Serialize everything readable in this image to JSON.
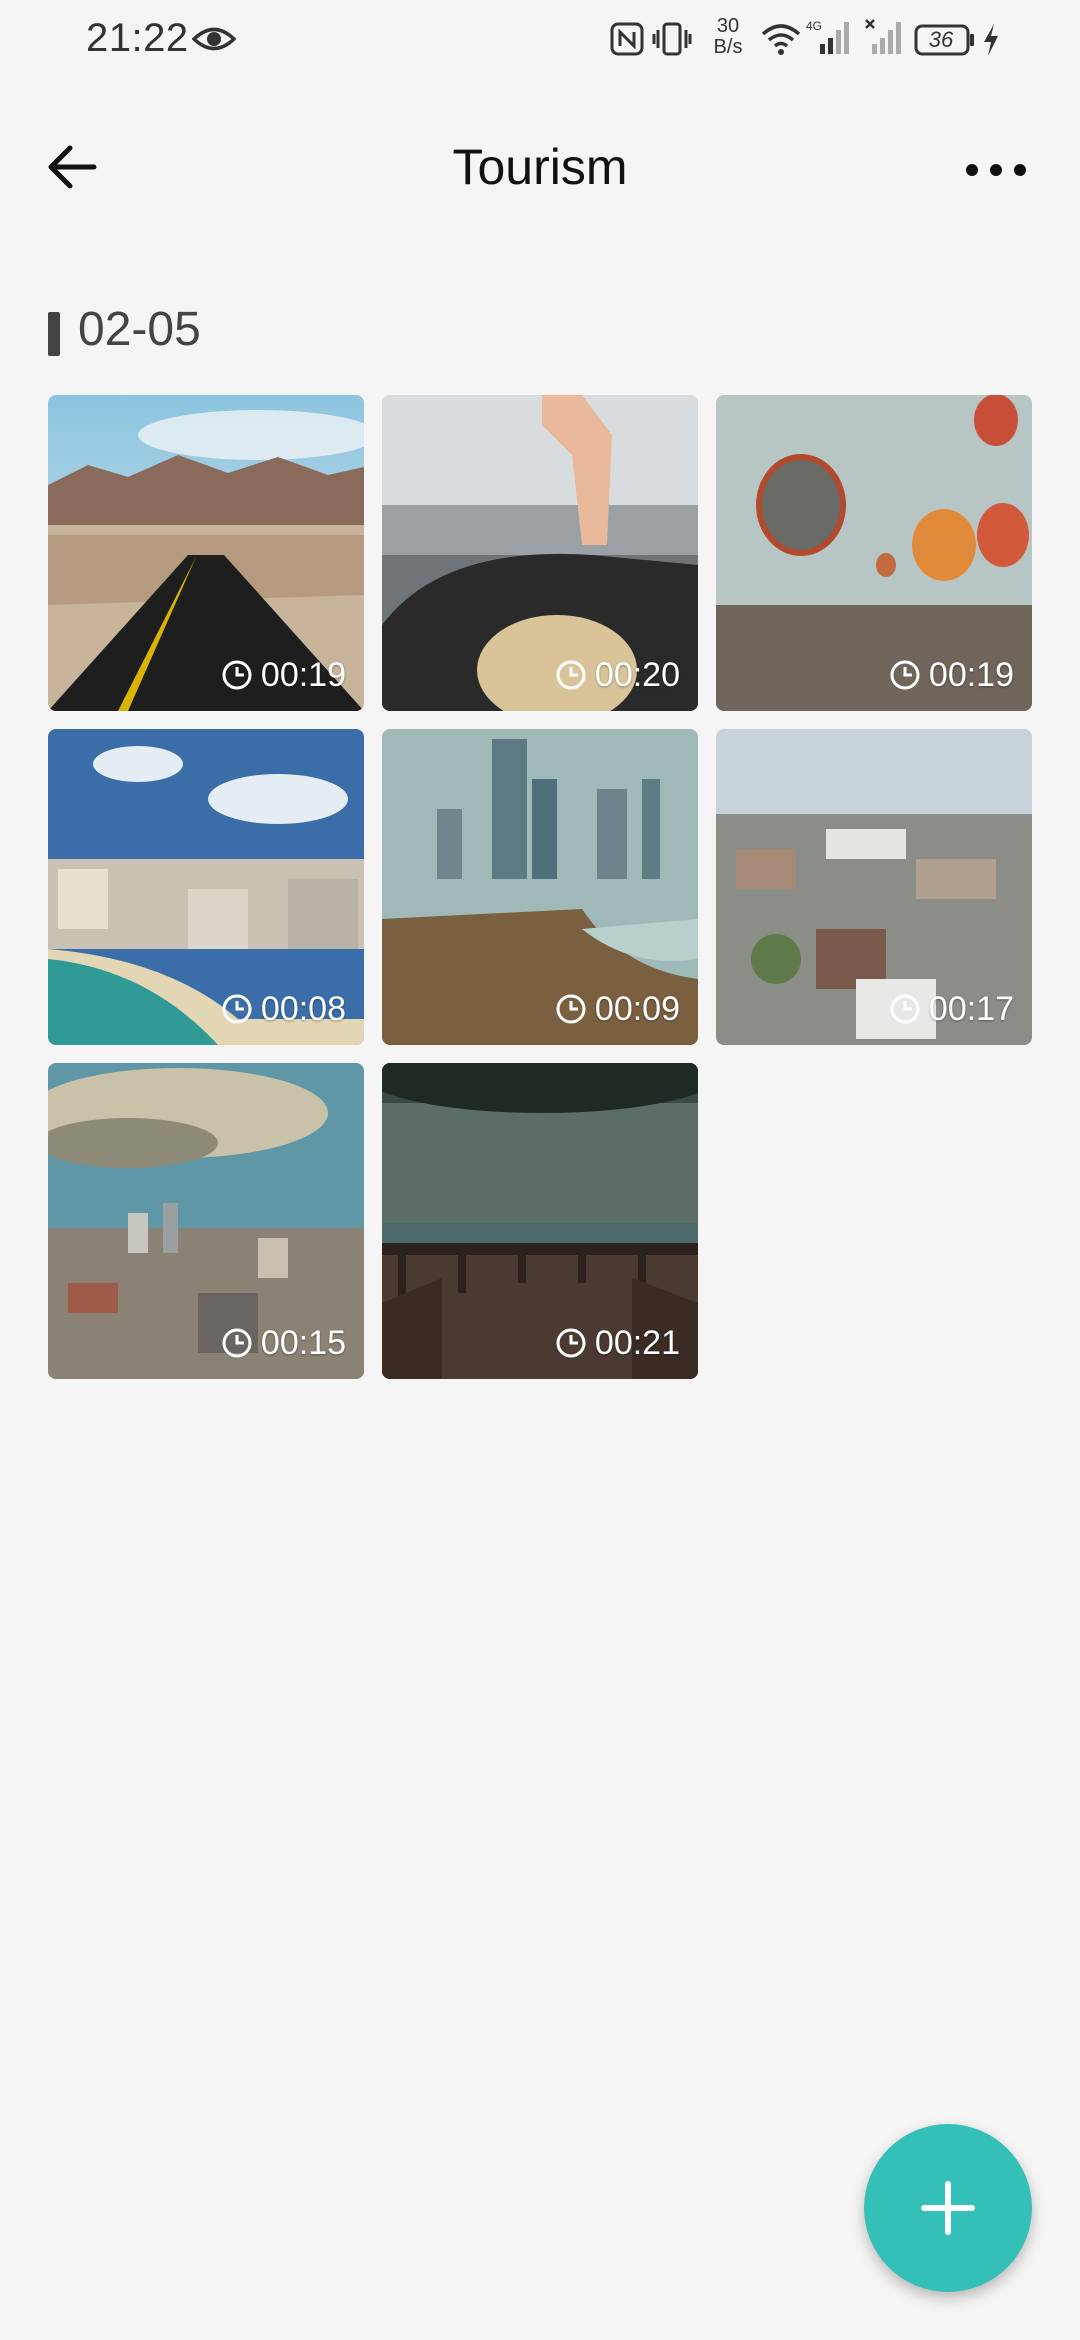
{
  "status_bar": {
    "time": "21:22",
    "speed_top": "30",
    "speed_bottom": "B/s",
    "battery": "36"
  },
  "app_bar": {
    "title": "Tourism"
  },
  "section": {
    "date": "02-05"
  },
  "videos": [
    {
      "duration": "00:19",
      "scene": "desert-road"
    },
    {
      "duration": "00:20",
      "scene": "convertible-car"
    },
    {
      "duration": "00:19",
      "scene": "hot-air-balloons"
    },
    {
      "duration": "00:08",
      "scene": "beach-city"
    },
    {
      "duration": "00:09",
      "scene": "city-skyline-river"
    },
    {
      "duration": "00:17",
      "scene": "town-aerial"
    },
    {
      "duration": "00:15",
      "scene": "cloudy-city"
    },
    {
      "duration": "00:21",
      "scene": "forest-deck"
    }
  ],
  "colors": {
    "accent": "#35bfb9",
    "background": "#f5f5f5"
  }
}
